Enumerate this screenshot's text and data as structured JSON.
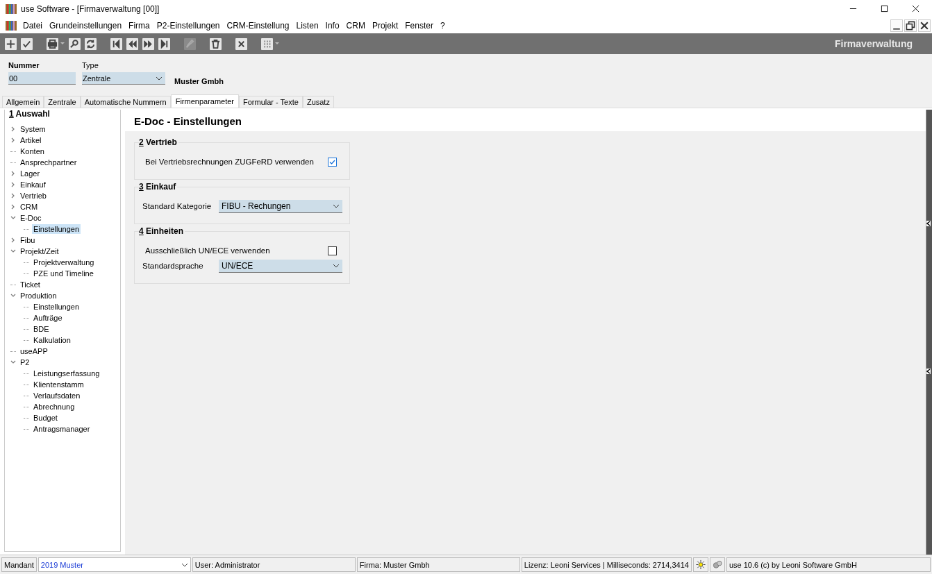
{
  "window": {
    "title": "use Software - [Firmaverwaltung [00]]"
  },
  "menu": [
    "Datei",
    "Grundeinstellungen",
    "Firma",
    "P2-Einstellungen",
    "CRM-Einstellung",
    "Listen",
    "Info",
    "CRM",
    "Projekt",
    "Fenster",
    "?"
  ],
  "toolbar": {
    "title": "Firmaverwaltung",
    "tools": [
      {
        "kind": "plus",
        "disabled": false
      },
      {
        "kind": "check",
        "disabled": false
      },
      {
        "kind": "print",
        "disabled": false
      },
      {
        "kind": "search",
        "disabled": false
      },
      {
        "kind": "refresh",
        "disabled": false
      },
      {
        "kind": "first",
        "disabled": false
      },
      {
        "kind": "prev",
        "disabled": false
      },
      {
        "kind": "next",
        "disabled": false
      },
      {
        "kind": "last",
        "disabled": false
      },
      {
        "kind": "edit",
        "disabled": true
      },
      {
        "kind": "delete",
        "disabled": false
      },
      {
        "kind": "cancel",
        "disabled": false
      },
      {
        "kind": "grid",
        "disabled": false
      }
    ]
  },
  "header": {
    "nummer_label": "Nummer",
    "nummer": "00",
    "type_label": "Type",
    "type": "Zentrale",
    "company": "Muster Gmbh"
  },
  "tabs": [
    {
      "label": "Allgemein",
      "selected": false
    },
    {
      "label": "Zentrale",
      "selected": false
    },
    {
      "label": "Automatische Nummern",
      "selected": false
    },
    {
      "label": "Firmenparameter",
      "selected": true
    },
    {
      "label": "Formular - Texte",
      "selected": false
    },
    {
      "label": "Zusatz",
      "selected": false
    }
  ],
  "tree": {
    "number": "1",
    "title": "Auswahl",
    "items": [
      {
        "label": "System",
        "expanded": false,
        "selected": false
      },
      {
        "label": "Artikel",
        "expanded": false,
        "selected": false
      },
      {
        "label": "Konten",
        "selected": false
      },
      {
        "label": "Ansprechpartner",
        "selected": false
      },
      {
        "label": "Lager",
        "expanded": false,
        "selected": false
      },
      {
        "label": "Einkauf",
        "expanded": false,
        "selected": false
      },
      {
        "label": "Vertrieb",
        "expanded": false,
        "selected": false
      },
      {
        "label": "CRM",
        "expanded": false,
        "selected": false
      },
      {
        "label": "E-Doc",
        "expanded": true,
        "selected": false,
        "children": [
          {
            "label": "Einstellungen",
            "selected": true
          }
        ]
      },
      {
        "label": "Fibu",
        "expanded": false,
        "selected": false
      },
      {
        "label": "Projekt/Zeit",
        "expanded": true,
        "selected": false,
        "children": [
          {
            "label": "Projektverwaltung",
            "selected": false
          },
          {
            "label": "PZE und Timeline",
            "selected": false
          }
        ]
      },
      {
        "label": "Ticket",
        "selected": false
      },
      {
        "label": "Produktion",
        "expanded": true,
        "selected": false,
        "children": [
          {
            "label": "Einstellungen",
            "selected": false
          },
          {
            "label": "Aufträge",
            "selected": false
          },
          {
            "label": "BDE",
            "selected": false
          },
          {
            "label": "Kalkulation",
            "selected": false
          }
        ]
      },
      {
        "label": "useAPP",
        "selected": false
      },
      {
        "label": "P2",
        "expanded": true,
        "selected": false,
        "children": [
          {
            "label": "Leistungserfassung",
            "selected": false
          },
          {
            "label": "Klientenstamm",
            "selected": false
          },
          {
            "label": "Verlaufsdaten",
            "selected": false
          },
          {
            "label": "Abrechnung",
            "selected": false
          },
          {
            "label": "Budget",
            "selected": false
          },
          {
            "label": "Antragsmanager",
            "selected": false
          }
        ]
      }
    ]
  },
  "content": {
    "title": "E-Doc - Einstellungen",
    "groups": [
      {
        "number": "2",
        "title": "Vertrieb",
        "rows": [
          {
            "kind": "checkbox",
            "label": "Bei Vertriebsrechnungen ZUGFeRD verwenden",
            "checked": true
          }
        ]
      },
      {
        "number": "3",
        "title": "Einkauf",
        "rows": [
          {
            "kind": "select",
            "label": "Standard Kategorie",
            "value": "FIBU - Rechungen"
          }
        ]
      },
      {
        "number": "4",
        "title": "Einheiten",
        "rows": [
          {
            "kind": "checkbox",
            "label": "Ausschließlich UN/ECE verwenden",
            "checked": false
          },
          {
            "kind": "select",
            "label": "Standardsprache",
            "value": "UN/ECE"
          }
        ]
      }
    ]
  },
  "status_bar": {
    "mandant_label": "Mandant",
    "mandant": "2019 Muster",
    "user": "User: Administrator",
    "firma": "Firma: Muster Gmbh",
    "lizenz": "Lizenz: Leoni Services | Milliseconds: 2714,3414",
    "version": "use 10.6 (c) by Leoni Software GmbH"
  }
}
